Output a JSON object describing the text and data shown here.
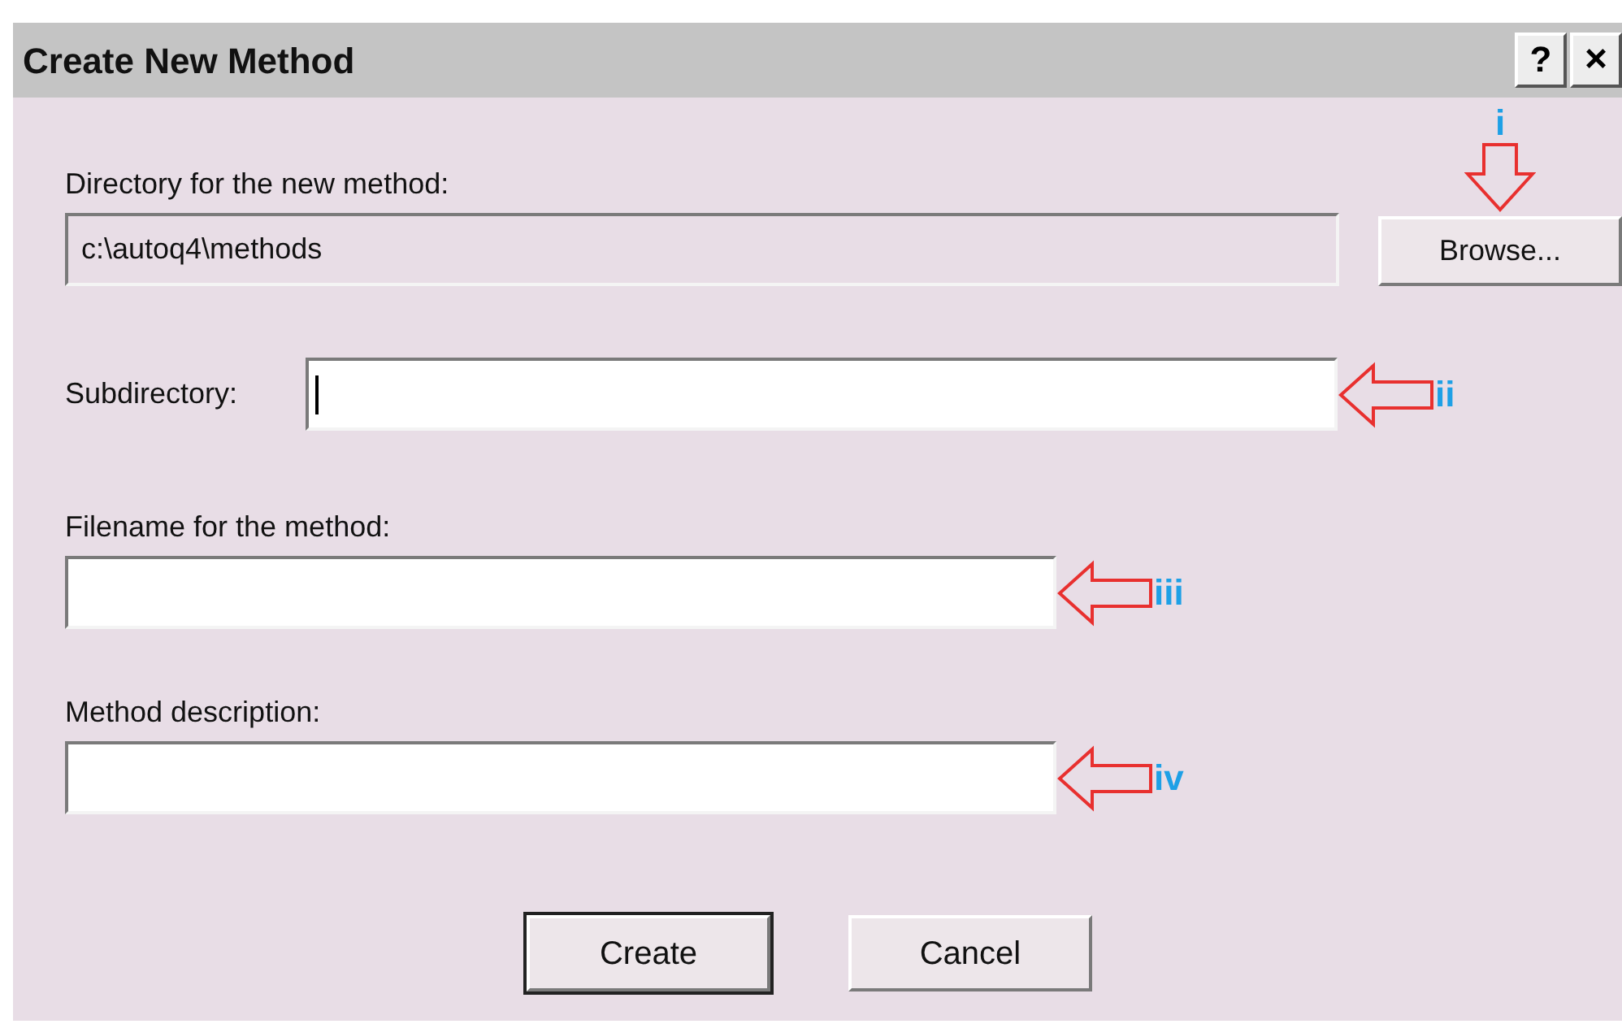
{
  "window": {
    "title": "Create New Method",
    "buttons": [
      {
        "kind": "help",
        "label": "?"
      },
      {
        "kind": "close",
        "label": "×"
      }
    ]
  },
  "directory": {
    "label": "Directory for the new method:",
    "value": "c:\\autoq4\\methods",
    "browse_button": "Browse...",
    "callout": "i"
  },
  "subdirectory": {
    "label": "Subdirectory:",
    "focused": true,
    "callout": "ii"
  },
  "filename": {
    "label": "Filename for the method:",
    "focused": false,
    "callout": "iii"
  },
  "description": {
    "label": "Method description:",
    "focused": false,
    "callout": "iv"
  },
  "buttons": [
    {
      "label": "Create",
      "default": true
    },
    {
      "label": "Cancel",
      "default": false
    }
  ]
}
